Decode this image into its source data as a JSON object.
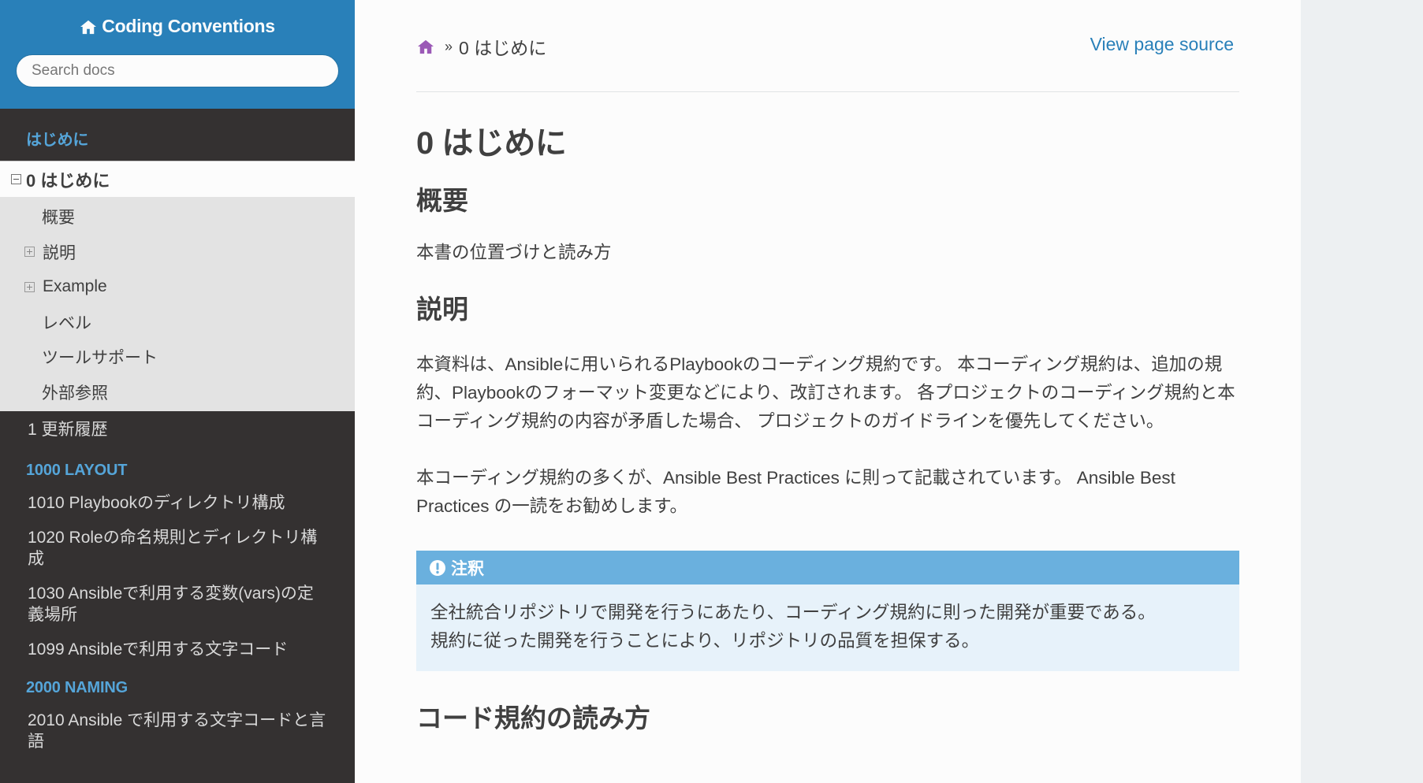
{
  "sidebar": {
    "brand": "Coding Conventions",
    "search_placeholder": "Search docs",
    "caption_intro": "はじめに",
    "current": "0 はじめに",
    "subitems": [
      {
        "label": "概要"
      },
      {
        "label": "説明"
      },
      {
        "label": "Example"
      },
      {
        "label": "レベル"
      },
      {
        "label": "ツールサポート"
      },
      {
        "label": "外部参照"
      }
    ],
    "history": "1 更新履歴",
    "caption_layout": "1000 LAYOUT",
    "layout_items": [
      {
        "label": "1010 Playbookのディレクトリ構成"
      },
      {
        "label": "1020 Roleの命名規則とディレクトリ構成"
      },
      {
        "label": "1030 Ansibleで利用する変数(vars)の定義場所"
      },
      {
        "label": "1099 Ansibleで利用する文字コード"
      }
    ],
    "caption_naming": "2000 NAMING",
    "naming_items": [
      {
        "label": "2010 Ansible で利用する文字コードと言語"
      }
    ]
  },
  "breadcrumb": {
    "separator": "»",
    "current": "0 はじめに",
    "view_source": "View page source"
  },
  "main": {
    "title": "0 はじめに",
    "h_overview": "概要",
    "p_overview": "本書の位置づけと読み方",
    "h_explain": "説明",
    "p_explain_1": "本資料は、Ansibleに用いられるPlaybookのコーディング規約です。 本コーディング規約は、追加の規約、Playbookのフォーマット変更などにより、改訂されます。 各プロジェクトのコーディング規約と本コーディング規約の内容が矛盾した場合、 プロジェクトのガイドラインを優先してください。",
    "p_explain_2": "本コーディング規約の多くが、Ansible Best Practices に則って記載されています。 Ansible Best Practices の一読をお勧めします。",
    "note": {
      "title": "注釈",
      "line1": "全社統合リポジトリで開発を行うにあたり、コーディング規約に則った開発が重要である。",
      "line2": "規約に従った開発を行うことにより、リポジトリの品質を担保する。"
    },
    "h_read": "コード規約の読み方"
  },
  "colors": {
    "sidebar_top": "#2980b9",
    "sidebar_bg": "#343131",
    "caption": "#55a5d9",
    "link": "#2980b9",
    "note_header": "#6ab0de",
    "note_bg": "#e7f2fa",
    "home_icon": "#9b59b6"
  },
  "icons": {
    "brand": "home-icon",
    "breadcrumb_home": "home-icon",
    "note": "exclamation-circle-icon"
  }
}
